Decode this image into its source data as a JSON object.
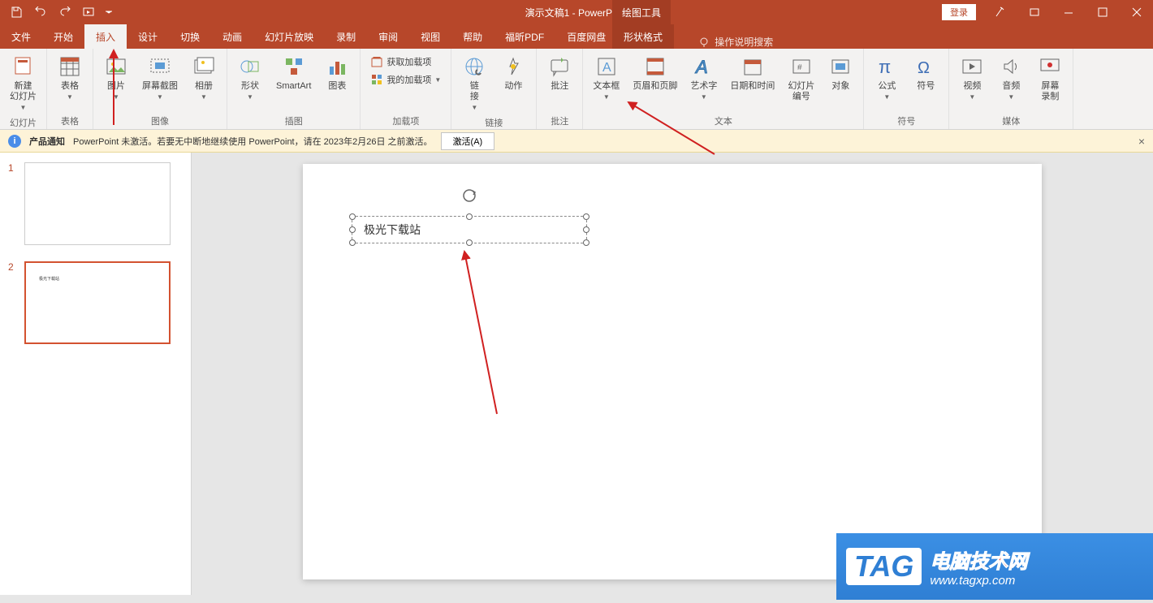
{
  "title": "演示文稿1 - PowerPoint",
  "drawing_tools": "绘图工具",
  "login": "登录",
  "menu": {
    "file": "文件",
    "home": "开始",
    "insert": "插入",
    "design": "设计",
    "transitions": "切换",
    "animations": "动画",
    "slideshow": "幻灯片放映",
    "record": "录制",
    "review": "审阅",
    "view": "视图",
    "help": "帮助",
    "foxit": "福昕PDF",
    "baidu": "百度网盘",
    "format": "形状格式",
    "tellme": "操作说明搜索"
  },
  "ribbon": {
    "new_slide": "新建\n幻灯片",
    "slides": "幻灯片",
    "table": "表格",
    "tables": "表格",
    "pictures": "图片",
    "screenshot": "屏幕截图",
    "album": "相册",
    "images": "图像",
    "shapes": "形状",
    "smartart": "SmartArt",
    "chart": "图表",
    "illustrations": "插图",
    "get_addins": "获取加载项",
    "my_addins": "我的加载项",
    "addins": "加载项",
    "link": "链\n接",
    "action": "动作",
    "links": "链接",
    "comment": "批注",
    "comments": "批注",
    "textbox": "文本框",
    "header_footer": "页眉和页脚",
    "wordart": "艺术字",
    "datetime": "日期和时间",
    "slide_number": "幻灯片\n编号",
    "object": "对象",
    "text": "文本",
    "equation": "公式",
    "symbol": "符号",
    "symbols": "符号",
    "video": "视频",
    "audio": "音频",
    "screen_rec": "屏幕\n录制",
    "media": "媒体"
  },
  "notice": {
    "label": "产品通知",
    "text": "PowerPoint 未激活。若要无中断地继续使用 PowerPoint，请在 2023年2月26日 之前激活。",
    "activate": "激活(A)"
  },
  "slides": {
    "s1": "1",
    "s2": "2",
    "thumb2_text": "极光下载站"
  },
  "textbox_content": "极光下载站",
  "watermark": {
    "tag": "TAG",
    "title": "电脑技术网",
    "url": "www.tagxp.com"
  }
}
